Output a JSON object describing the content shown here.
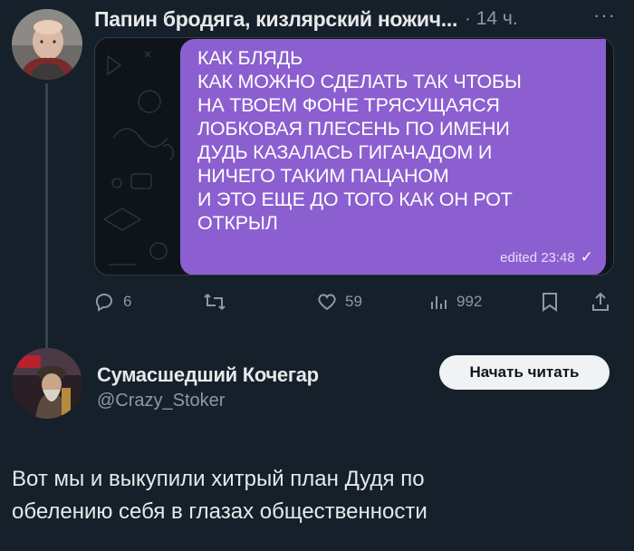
{
  "tweet1": {
    "author_name": "Папин бродяга, кизлярский ножич...",
    "separator": "·",
    "time": "14 ч.",
    "more": "···",
    "media": {
      "message_lines": [
        "КАК БЛЯДЬ",
        "КАК МОЖНО СДЕЛАТЬ ТАК ЧТОБЫ",
        "НА ТВОЕМ ФОНЕ ТРЯСУЩАЯСЯ",
        "ЛОБКОВАЯ ПЛЕСЕНЬ ПО ИМЕНИ",
        "ДУДЬ КАЗАЛАСЬ ГИГАЧАДОМ И",
        "НИЧЕГО ТАКИМ ПАЦАНОМ",
        "И ЭТО ЕЩЕ ДО ТОГО КАК ОН РОТ",
        "ОТКРЫЛ"
      ],
      "meta": "edited 23:48",
      "bubble_color": "#8b5fd0"
    },
    "actions": {
      "replies": "6",
      "retweets": "",
      "likes": "59",
      "views": "992"
    }
  },
  "tweet2": {
    "author_name": "Сумасшедший Кочегар",
    "handle": "@Crazy_Stoker",
    "follow_label": "Начать читать",
    "text_lines": [
      "Вот мы и выкупили хитрый план Дудя по",
      "обелению себя в глазах общественности"
    ]
  },
  "colors": {
    "background": "#15202b",
    "text": "#e7e9ea",
    "muted": "#8b98a5"
  }
}
